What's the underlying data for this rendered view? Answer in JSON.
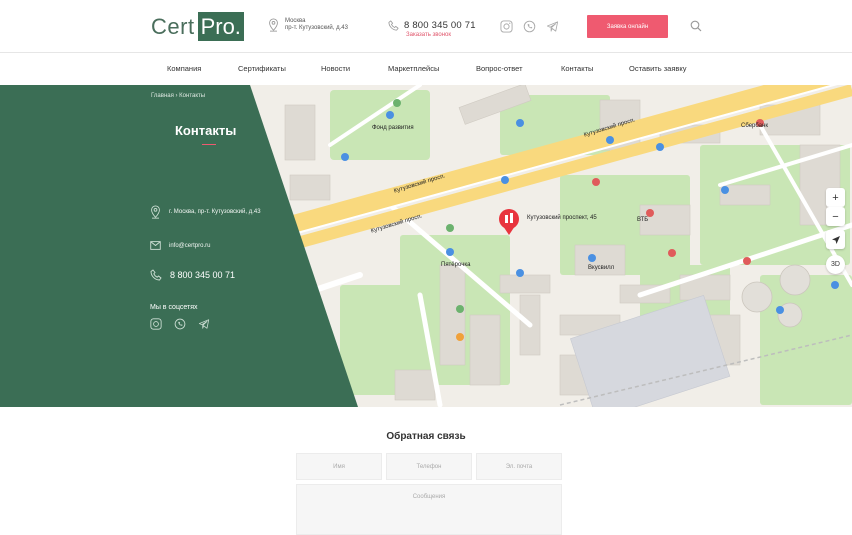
{
  "header": {
    "logo_cert": "Cert",
    "logo_pro": "Pro.",
    "address_line1": "Москва",
    "address_line2": "пр-т. Кутузовский, д.43",
    "phone": "8 800 345 00 71",
    "callback": "Заказать звонок",
    "apply_button": "Заявка онлайн"
  },
  "nav": {
    "items": [
      "Компания",
      "Сертификаты",
      "Новости",
      "Маркетплейсы",
      "Вопрос-ответ",
      "Контакты",
      "Оставить заявку"
    ]
  },
  "contacts": {
    "breadcrumb": "Главная  ›  Контакты",
    "title": "Контакты",
    "address": "г. Москва, пр-т. Кутузовский, д.43",
    "email": "info@certpro.ru",
    "phone": "8 800 345 00 71",
    "socials_title": "Мы в соцсетях"
  },
  "map": {
    "marker_label": "Кутузовский проспект, 45",
    "street_labels": [
      "Кутузовский просп.",
      "Кутузовский просп.",
      "Кутузовский просп."
    ],
    "labels": [
      "Фонд развития",
      "ВТБ",
      "Пятёрочка",
      "Вкусвилл",
      "Сбербанк"
    ],
    "zoom_in": "+",
    "zoom_out": "−",
    "three_d": "3D"
  },
  "feedback": {
    "title": "Обратная связь",
    "name_placeholder": "Имя",
    "phone_placeholder": "Телефон",
    "email_placeholder": "Эл. почта",
    "message_placeholder": "Сообщения"
  },
  "colors": {
    "brand_green": "#3b6e55",
    "accent_pink": "#ef5a70"
  }
}
